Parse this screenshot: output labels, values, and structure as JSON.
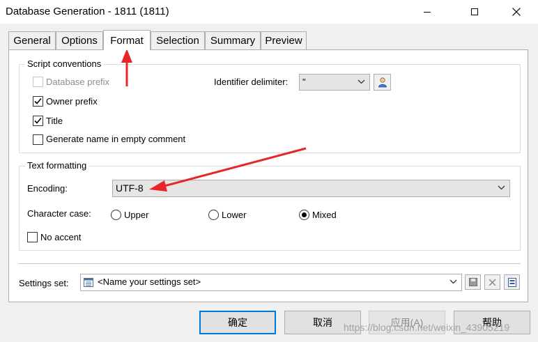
{
  "window": {
    "title": "Database Generation - 1811 (1811)"
  },
  "tabs": [
    {
      "label": "General",
      "active": false
    },
    {
      "label": "Options",
      "active": false
    },
    {
      "label": "Format",
      "active": true
    },
    {
      "label": "Selection",
      "active": false
    },
    {
      "label": "Summary",
      "active": false
    },
    {
      "label": "Preview",
      "active": false
    }
  ],
  "script_conventions": {
    "title": "Script conventions",
    "database_prefix": {
      "label": "Database prefix",
      "checked": false,
      "enabled": false
    },
    "owner_prefix": {
      "label": "Owner prefix",
      "checked": true
    },
    "title_option": {
      "label": "Title",
      "checked": true
    },
    "generate_name": {
      "label": "Generate name in empty comment",
      "checked": false
    },
    "identifier_delimiter": {
      "label": "Identifier delimiter:",
      "value": "\""
    }
  },
  "text_formatting": {
    "title": "Text formatting",
    "encoding": {
      "label": "Encoding:",
      "value": "UTF-8"
    },
    "character_case": {
      "label": "Character case:",
      "options": [
        "Upper",
        "Lower",
        "Mixed"
      ],
      "selected": "Mixed"
    },
    "no_accent": {
      "label": "No accent",
      "checked": false
    }
  },
  "settings_set": {
    "label": "Settings set:",
    "value": "<Name your settings set>"
  },
  "buttons": {
    "ok": "确定",
    "cancel": "取消",
    "apply": "应用(A)",
    "help": "帮助"
  },
  "watermark": "https://blog.csdn.net/weixin_43905219",
  "colors": {
    "annotation_arrow": "#e8262a",
    "default_button_border": "#0078d7"
  }
}
